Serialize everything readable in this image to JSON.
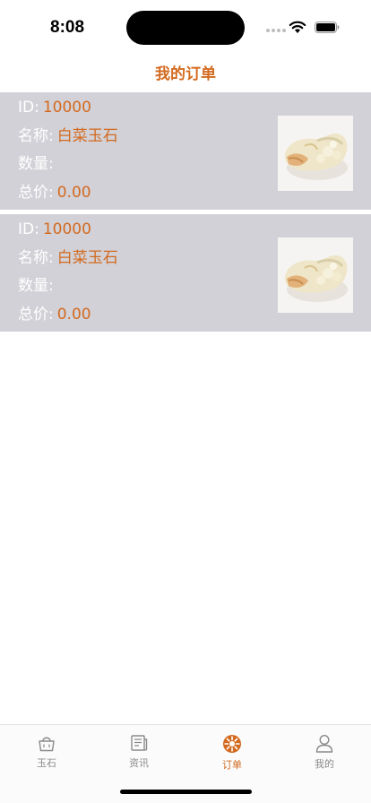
{
  "status_bar": {
    "time": "8:08"
  },
  "nav": {
    "title": "我的订单"
  },
  "labels": {
    "id": "ID:",
    "name": "名称:",
    "quantity": "数量:",
    "total": "总价:"
  },
  "orders": [
    {
      "id": "10000",
      "name": "白菜玉石",
      "quantity": "",
      "total": "0.00"
    },
    {
      "id": "10000",
      "name": "白菜玉石",
      "quantity": "",
      "total": "0.00"
    }
  ],
  "tabs": [
    {
      "label": "玉石",
      "icon": "shopping-bag-icon"
    },
    {
      "label": "资讯",
      "icon": "news-icon"
    },
    {
      "label": "订单",
      "icon": "orders-icon",
      "active": true
    },
    {
      "label": "我的",
      "icon": "person-icon"
    }
  ],
  "colors": {
    "accent": "#d36a1f",
    "card_bg": "#d2d1d7",
    "inactive": "#8a8a8a"
  }
}
